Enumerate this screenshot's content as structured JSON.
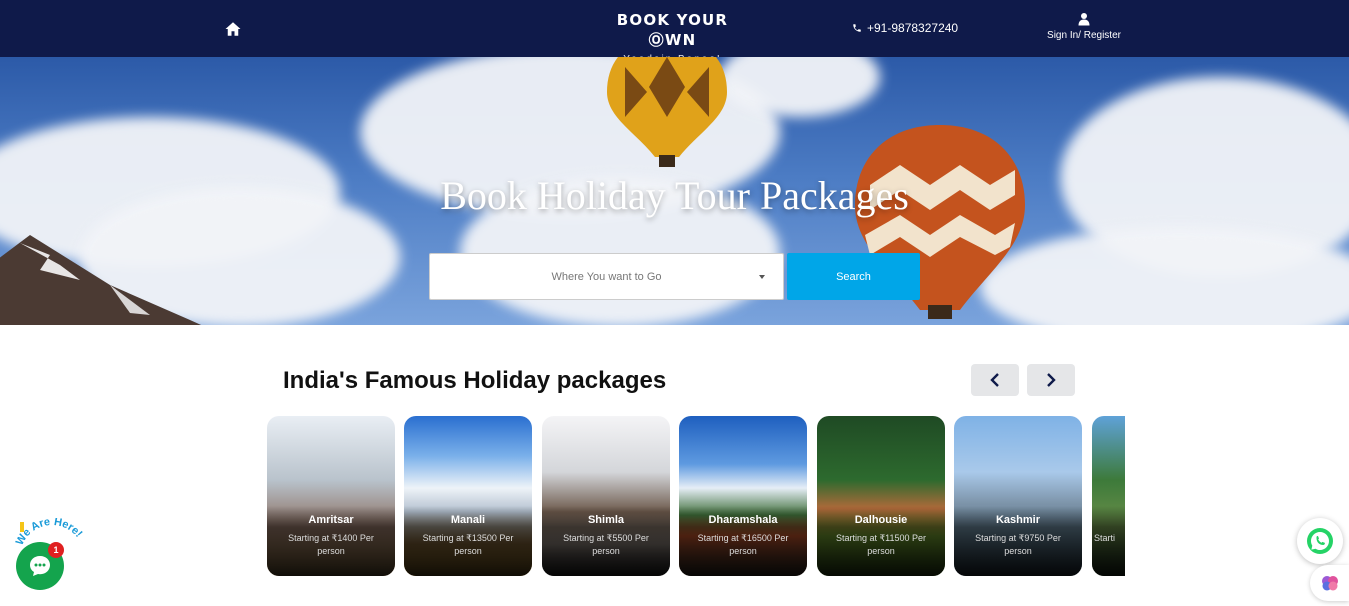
{
  "header": {
    "brand_title": "BOOK YOUR ⓄWN",
    "brand_subtitle": "Yaadein Banao!",
    "phone": "+91-9878327240",
    "signin_label": "Sign In/ Register",
    "icons": {
      "home": "home-icon",
      "phone": "phone-icon",
      "user": "user-icon"
    }
  },
  "hero": {
    "title": "Book Holiday Tour Packages",
    "destination_placeholder": "Where You want to Go",
    "search_label": "Search"
  },
  "packages": {
    "title": "India's Famous Holiday packages",
    "items": [
      {
        "name": "Amritsar",
        "price": "Starting at ₹1400 Per person"
      },
      {
        "name": "Manali",
        "price": "Starting at ₹13500 Per person"
      },
      {
        "name": "Shimla",
        "price": "Starting at ₹5500 Per person"
      },
      {
        "name": "Dharamshala",
        "price": "Starting at ₹16500 Per person"
      },
      {
        "name": "Dalhousie",
        "price": "Starting at ₹11500 Per person"
      },
      {
        "name": "Kashmir",
        "price": "Starting at ₹9750 Per person"
      },
      {
        "name": "",
        "price": "Starti"
      }
    ]
  },
  "widgets": {
    "chat_badge": "1",
    "chat_tagline": "We Are Here!"
  },
  "colors": {
    "header_bg": "#0f1a4a",
    "search_button": "#00a6e8",
    "chat_green": "#14a44d",
    "badge_red": "#e02020"
  }
}
